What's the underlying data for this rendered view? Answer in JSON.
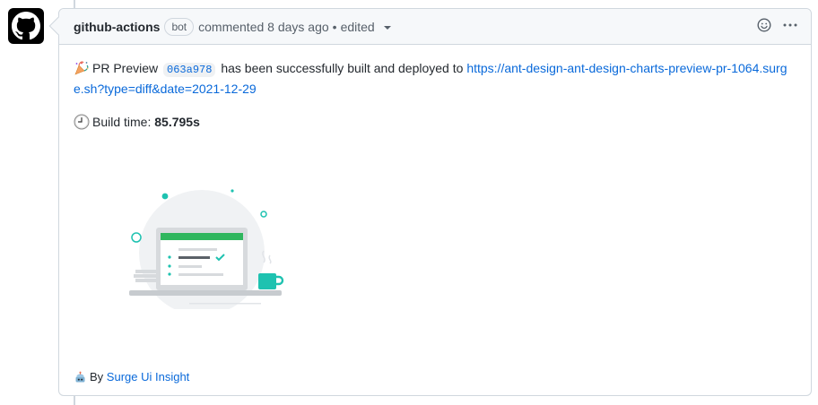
{
  "comment": {
    "author": "github-actions",
    "badge": "bot",
    "action": "commented 8 days ago",
    "separator": "•",
    "edited": "edited"
  },
  "body": {
    "preview_label": "PR Preview",
    "commit_sha": "063a978",
    "deploy_text": "has been successfully built and deployed to",
    "deploy_url": "https://ant-design-ant-design-charts-preview-pr-1064.surge.sh?type=diff&date=2021-12-29",
    "build_label": "Build time:",
    "build_time": "85.795s",
    "footer_prefix": "By",
    "footer_link": "Surge Ui Insight"
  },
  "icons": {
    "avatar": "github-octocat-icon",
    "preview": "confetti-icon",
    "build": "clock-icon",
    "footer": "robot-icon",
    "reaction": "smiley-icon",
    "more": "kebab-icon"
  },
  "colors": {
    "link": "#0969da",
    "accent_green": "#2fb65d",
    "accent_teal": "#1ec2b0"
  }
}
